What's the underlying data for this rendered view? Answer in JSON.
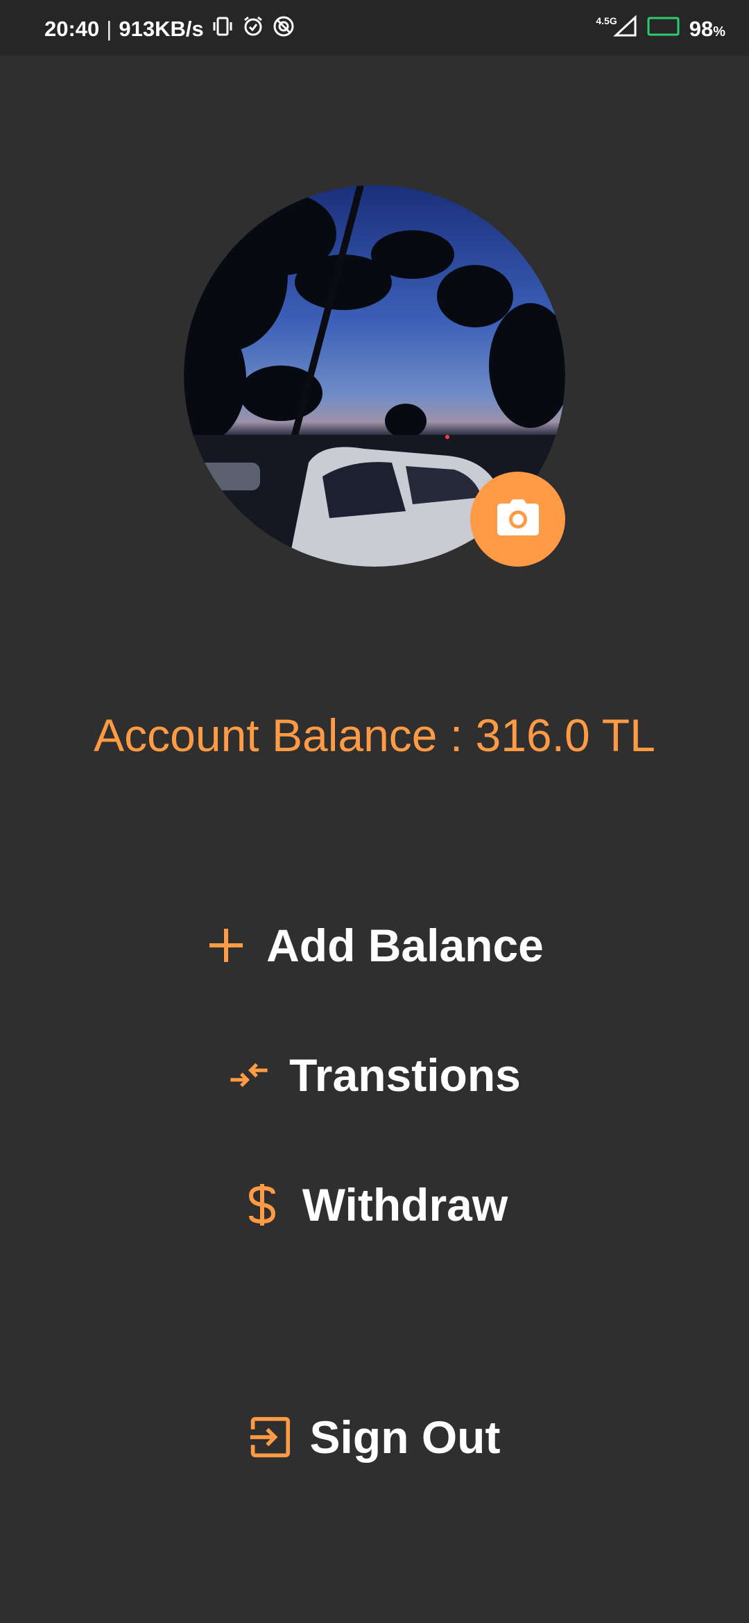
{
  "status_bar": {
    "time": "20:40",
    "separator": "|",
    "net_speed": "913KB/s",
    "network_type": "4.5G",
    "battery_percent": "98",
    "battery_unit": "%"
  },
  "profile": {
    "avatar_alt": "Profile photo",
    "camera_icon": "camera-icon"
  },
  "account": {
    "balance_text": "Account Balance : 316.0 TL"
  },
  "menu": {
    "add_balance": "Add Balance",
    "transactions": "Transtions",
    "withdraw": "Withdraw",
    "sign_out": "Sign Out"
  },
  "colors": {
    "accent": "#ff9a45",
    "background": "#2f2f2f",
    "text": "#ffffff"
  }
}
